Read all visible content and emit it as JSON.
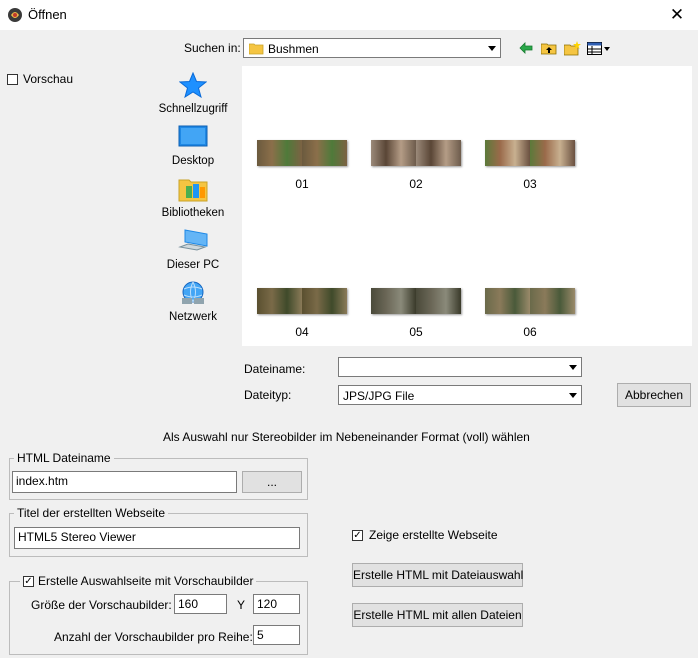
{
  "window": {
    "title": "Öffnen"
  },
  "lookin": {
    "label": "Suchen in:",
    "folder": "Bushmen"
  },
  "preview": {
    "label": "Vorschau",
    "checked": false
  },
  "places": [
    {
      "label": "Schnellzugriff",
      "icon": "star-icon"
    },
    {
      "label": "Desktop",
      "icon": "desktop-icon"
    },
    {
      "label": "Bibliotheken",
      "icon": "libraries-icon"
    },
    {
      "label": "Dieser PC",
      "icon": "computer-icon"
    },
    {
      "label": "Netzwerk",
      "icon": "network-icon"
    }
  ],
  "files": [
    {
      "name": "01"
    },
    {
      "name": "02"
    },
    {
      "name": "03"
    },
    {
      "name": "04"
    },
    {
      "name": "05"
    },
    {
      "name": "06"
    }
  ],
  "filename": {
    "label": "Dateiname:",
    "value": ""
  },
  "filetype": {
    "label": "Dateityp:",
    "value": "JPS/JPG File"
  },
  "cancel_label": "Abbrechen",
  "hint": "Als Auswahl nur Stereobilder im Nebeneinander Format (voll) wählen",
  "html_filename": {
    "legend": "HTML Dateiname",
    "value": "index.htm",
    "browse_label": "..."
  },
  "page_title": {
    "legend": "Titel der erstellten Webseite",
    "value": "HTML5 Stereo Viewer"
  },
  "thumbs_group": {
    "legend": "Erstelle Auswahlseite mit Vorschaubilder",
    "checked": true,
    "size_label": "Größe der Vorschaubilder: X",
    "x_value": "160",
    "y_label": "Y",
    "y_value": "120",
    "per_row_label": "Anzahl der Vorschaubilder pro Reihe:",
    "per_row_value": "5"
  },
  "show_page": {
    "label": "Zeige erstellte Webseite",
    "checked": true
  },
  "buttons": {
    "create_selection": "Erstelle HTML mit Dateiauswahl",
    "create_all": "Erstelle HTML mit allen Dateien"
  },
  "colors": {
    "accent": "#0078d7",
    "folder": "#f5c542"
  }
}
